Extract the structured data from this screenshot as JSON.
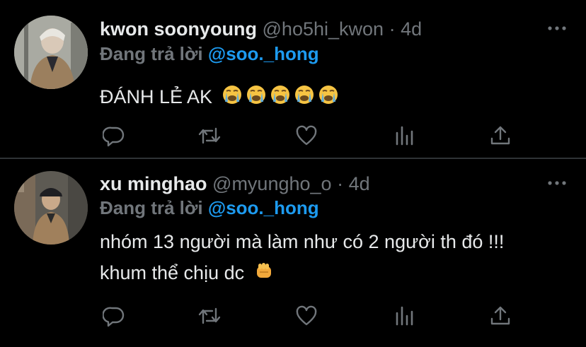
{
  "tweets": [
    {
      "name": "kwon soonyoung",
      "handle": "@ho5hi_kwon",
      "dot": "·",
      "time": "4d",
      "reply_prefix": "Đang trả lời",
      "reply_to": "@soo._hong",
      "body_lines": [
        "ĐÁNH LẺ AK"
      ],
      "emojis": [
        "crying-face",
        "crying-face",
        "crying-face",
        "crying-face",
        "crying-face"
      ]
    },
    {
      "name": "xu minghao",
      "handle": "@myungho_o",
      "dot": "·",
      "time": "4d",
      "reply_prefix": "Đang trả lời",
      "reply_to": "@soo._hong",
      "body_lines": [
        "nhóm 13 người mà làm như có 2 người th đó !!!",
        "khum thể chịu dc"
      ],
      "emojis": [
        "oncoming-fist"
      ]
    }
  ],
  "actions": [
    "reply-icon",
    "retweet-icon",
    "like-icon",
    "analytics-icon",
    "share-icon"
  ],
  "colors": {
    "background": "#000000",
    "text": "#e7e9ea",
    "secondary": "#71767b",
    "accent": "#1d9bf0",
    "divider": "#2f3336"
  }
}
